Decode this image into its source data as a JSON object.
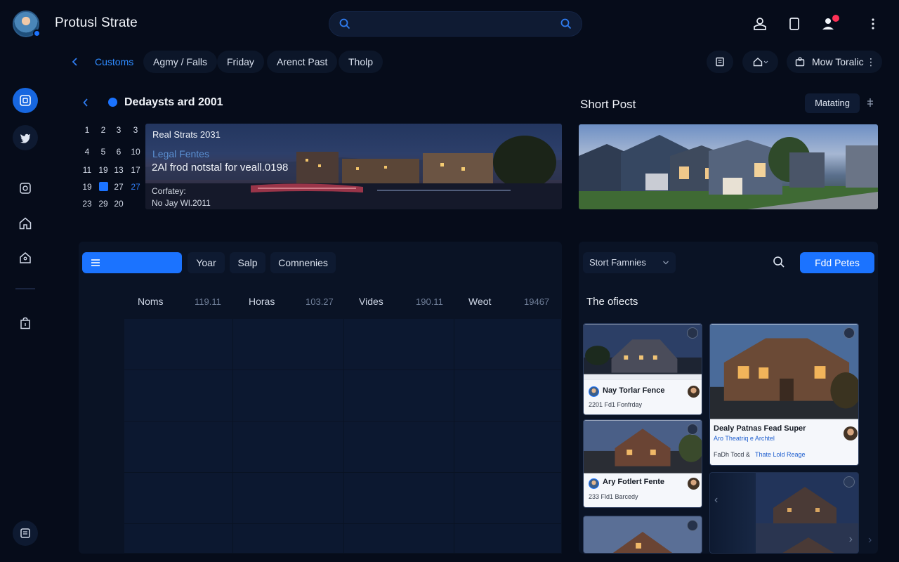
{
  "app": {
    "title": "Protusl Strate"
  },
  "search": {
    "placeholder": ""
  },
  "nav": {
    "tabs": [
      {
        "label": "Customs"
      },
      {
        "label": "Agmy / Falls"
      },
      {
        "label": "Friday"
      },
      {
        "label": "Arenct Past"
      },
      {
        "label": "Tholp"
      }
    ],
    "account_label": "Mow Toralic"
  },
  "calendar": {
    "title": "Dedaysts ard 2001",
    "rows": [
      [
        "1",
        "2",
        "3",
        "3"
      ],
      [
        "4",
        "5",
        "6",
        "10"
      ],
      [
        "11",
        "19",
        "13",
        "17"
      ],
      [
        "19",
        "",
        "27",
        "27"
      ],
      [
        "23",
        "29",
        "20",
        ""
      ]
    ]
  },
  "hero": {
    "line1": "Real Strats 2031",
    "line2": "Legal Fentes",
    "line3": "2Al frod notstal for veall.0198",
    "line4": "Corfatey:",
    "line5": "No Jay Wl.2011"
  },
  "short_post": {
    "title": "Short Post",
    "button_label": "Matating"
  },
  "schedule": {
    "tabs": [
      "",
      "Yoar",
      "Salp",
      "Comnenies"
    ],
    "columns": [
      {
        "name": "Noms",
        "value": "119.11"
      },
      {
        "name": "Horas",
        "value": "103.27"
      },
      {
        "name": "Vides",
        "value": "190.11"
      },
      {
        "name": "Weot",
        "value": "19467"
      }
    ]
  },
  "objects": {
    "sort_label": "Stort Famnies",
    "add_button": "Fdd Petes",
    "title": "The ofiects",
    "cards": [
      {
        "title": "Nay Torlar Fence",
        "sub": "2201 Fd1 Fonfrday"
      },
      {
        "title": "Dealy Patnas Fead Super",
        "link": "Aro Theatriq e Archtel",
        "sub": "FaDh Tocd &",
        "sub_link": "Thate Lold Reage"
      },
      {
        "title": "Ary Fotlert Fente",
        "sub": "233 Fld1 Barcedy"
      }
    ]
  },
  "icons": {
    "search_left": "search-icon",
    "search_right": "search-icon",
    "header": [
      "profile-icon",
      "document-icon",
      "notifications-user-icon",
      "more-vertical-icon"
    ],
    "rail": [
      "dashboard-icon",
      "twitter-icon",
      "gallery-icon",
      "home-icon",
      "tag-icon",
      "bag-icon",
      "archive-icon"
    ]
  },
  "colors": {
    "accent": "#1b73ff",
    "background": "#060c1a",
    "panel": "#0a1325",
    "badge": "#ff3156"
  }
}
